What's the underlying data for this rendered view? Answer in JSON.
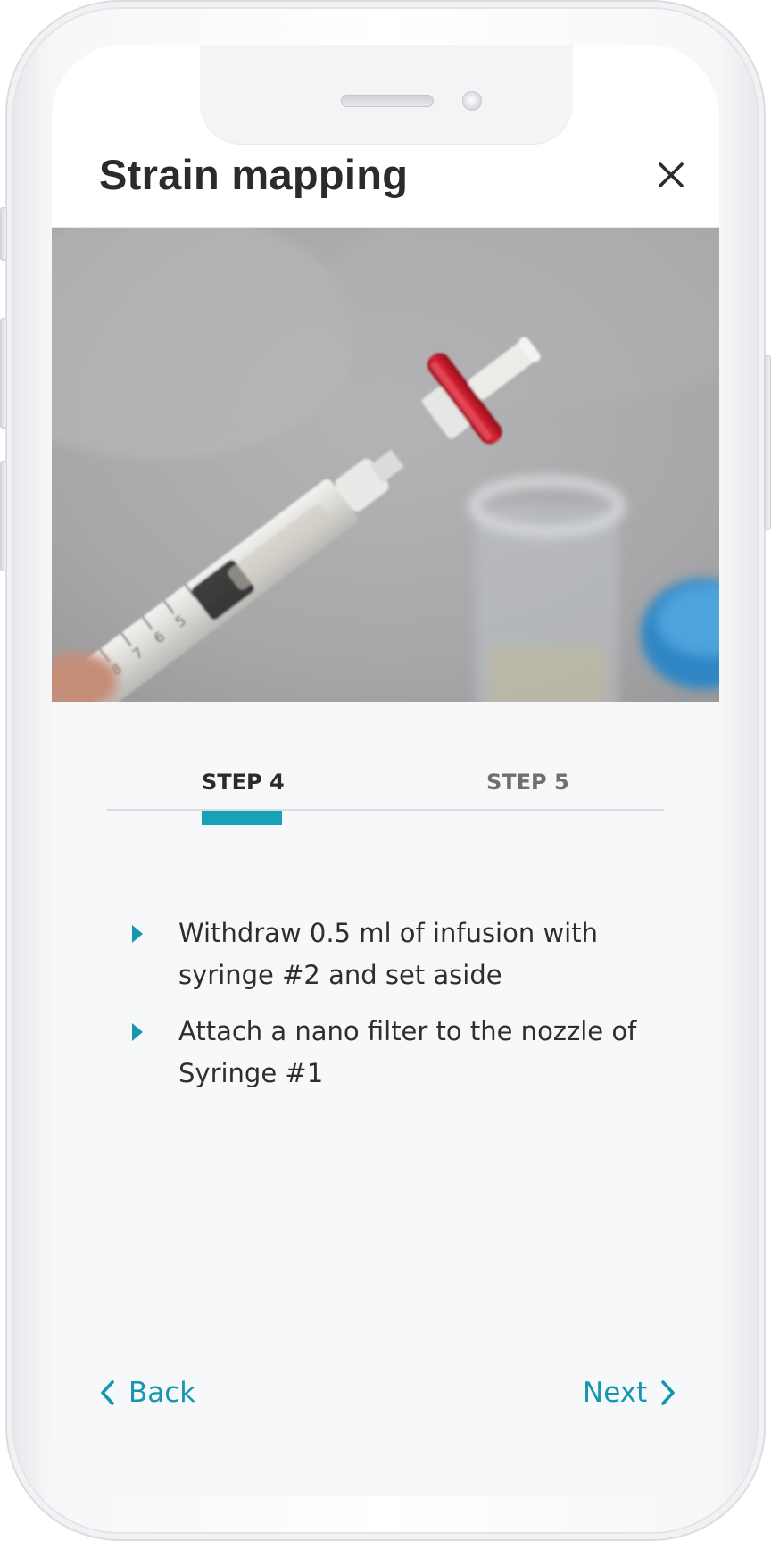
{
  "header": {
    "title": "Strain mapping",
    "close_icon": "close-icon"
  },
  "photo": {
    "subject": "syringe-with-red-nano-filter"
  },
  "tabs": [
    {
      "label": "STEP 4",
      "active": true
    },
    {
      "label": "STEP 5",
      "active": false
    }
  ],
  "steps": [
    {
      "text": "Withdraw 0.5 ml of infusion with syringe #2 and set aside"
    },
    {
      "text": "Attach a nano filter to the nozzle of Syringe #1"
    }
  ],
  "nav": {
    "back_label": "Back",
    "next_label": "Next",
    "back_icon": "chevron-left-icon",
    "next_icon": "chevron-right-icon"
  },
  "colors": {
    "accent": "#17a2b8",
    "text": "#2b2b2b",
    "inactive_tab": "#6f6f6f",
    "background": "#f7f8fa"
  }
}
